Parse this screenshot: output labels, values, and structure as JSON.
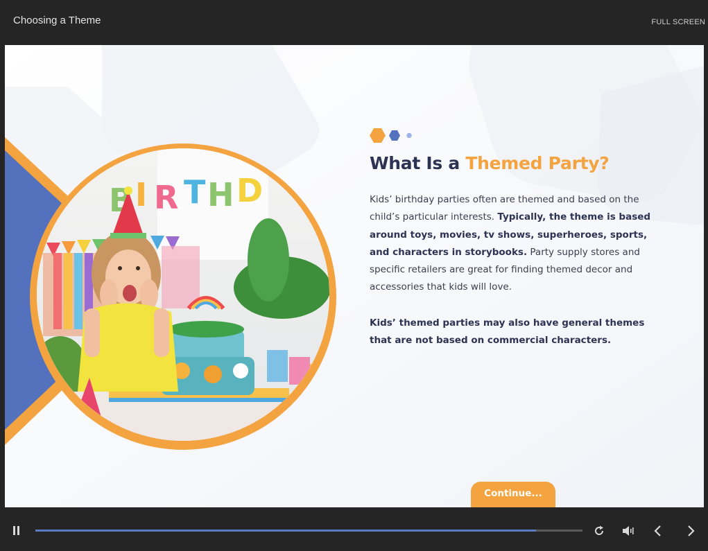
{
  "header": {
    "course_title": "Choosing a Theme",
    "fullscreen_label": "FULL SCREEN"
  },
  "slide": {
    "heading_main": "What Is a ",
    "heading_accent": "Themed Party?",
    "paragraph1_plain1": "Kids’ birthday parties often are themed and based on the child’s particular interests. ",
    "paragraph1_bold": "Typically, the theme is based around toys, movies, tv shows, superheroes, sports, and characters in storybooks.",
    "paragraph1_plain2": "  Party supply stores and specific retailers are great for finding themed decor and accessories that kids will love.",
    "paragraph2_bold": "Kids’ themed parties may also have general themes that are not based on commercial characters.",
    "continue_label": "Continue...",
    "photo_banner_text": "BIRTHDAY"
  },
  "player": {
    "progress": 0.915,
    "icons": [
      "pause-icon",
      "replay-icon",
      "volume-icon",
      "chevron-left-icon",
      "chevron-right-icon"
    ]
  },
  "colors": {
    "accent_orange": "#f3a340",
    "accent_blue": "#5371bd",
    "heading_navy": "#2d3353",
    "bar_background": "#252525",
    "progress_blue": "#5b7bc3"
  }
}
